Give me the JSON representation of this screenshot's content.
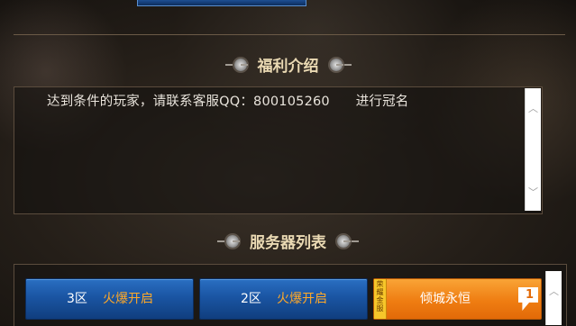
{
  "intro": {
    "title": "福利介绍",
    "text": "达到条件的玩家，请联系客服QQ：800105260      进行冠名"
  },
  "server_list": {
    "title": "服务器列表",
    "servers": [
      {
        "zone": "3区",
        "status": "火爆开启"
      },
      {
        "zone": "2区",
        "status": "火爆开启"
      }
    ],
    "featured": {
      "tag": "荣耀金服",
      "name": "倾城永恒",
      "rank": "1"
    }
  },
  "scroll": {
    "up_glyph": "︿",
    "down_glyph": "﹀"
  },
  "colors": {
    "blue_button": "#1a55a3",
    "orange_button": "#ef7d12",
    "status_orange": "#ffa928",
    "title_text": "#ead9b3"
  }
}
